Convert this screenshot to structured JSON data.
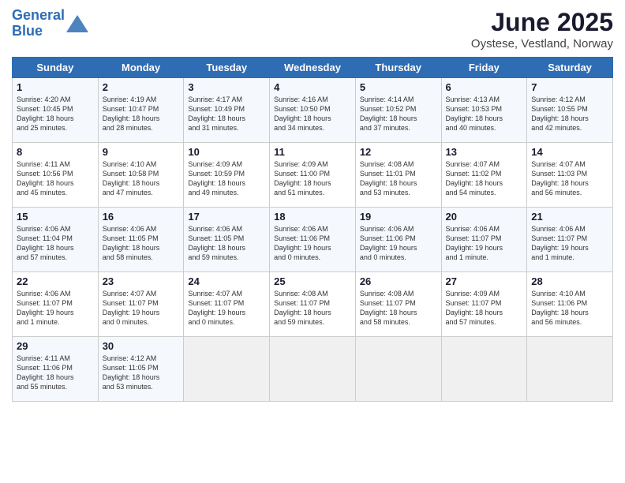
{
  "logo": {
    "line1": "General",
    "line2": "Blue"
  },
  "title": "June 2025",
  "location": "Oystese, Vestland, Norway",
  "days_of_week": [
    "Sunday",
    "Monday",
    "Tuesday",
    "Wednesday",
    "Thursday",
    "Friday",
    "Saturday"
  ],
  "weeks": [
    [
      {
        "day": "1",
        "info": "Sunrise: 4:20 AM\nSunset: 10:45 PM\nDaylight: 18 hours\nand 25 minutes."
      },
      {
        "day": "2",
        "info": "Sunrise: 4:19 AM\nSunset: 10:47 PM\nDaylight: 18 hours\nand 28 minutes."
      },
      {
        "day": "3",
        "info": "Sunrise: 4:17 AM\nSunset: 10:49 PM\nDaylight: 18 hours\nand 31 minutes."
      },
      {
        "day": "4",
        "info": "Sunrise: 4:16 AM\nSunset: 10:50 PM\nDaylight: 18 hours\nand 34 minutes."
      },
      {
        "day": "5",
        "info": "Sunrise: 4:14 AM\nSunset: 10:52 PM\nDaylight: 18 hours\nand 37 minutes."
      },
      {
        "day": "6",
        "info": "Sunrise: 4:13 AM\nSunset: 10:53 PM\nDaylight: 18 hours\nand 40 minutes."
      },
      {
        "day": "7",
        "info": "Sunrise: 4:12 AM\nSunset: 10:55 PM\nDaylight: 18 hours\nand 42 minutes."
      }
    ],
    [
      {
        "day": "8",
        "info": "Sunrise: 4:11 AM\nSunset: 10:56 PM\nDaylight: 18 hours\nand 45 minutes."
      },
      {
        "day": "9",
        "info": "Sunrise: 4:10 AM\nSunset: 10:58 PM\nDaylight: 18 hours\nand 47 minutes."
      },
      {
        "day": "10",
        "info": "Sunrise: 4:09 AM\nSunset: 10:59 PM\nDaylight: 18 hours\nand 49 minutes."
      },
      {
        "day": "11",
        "info": "Sunrise: 4:09 AM\nSunset: 11:00 PM\nDaylight: 18 hours\nand 51 minutes."
      },
      {
        "day": "12",
        "info": "Sunrise: 4:08 AM\nSunset: 11:01 PM\nDaylight: 18 hours\nand 53 minutes."
      },
      {
        "day": "13",
        "info": "Sunrise: 4:07 AM\nSunset: 11:02 PM\nDaylight: 18 hours\nand 54 minutes."
      },
      {
        "day": "14",
        "info": "Sunrise: 4:07 AM\nSunset: 11:03 PM\nDaylight: 18 hours\nand 56 minutes."
      }
    ],
    [
      {
        "day": "15",
        "info": "Sunrise: 4:06 AM\nSunset: 11:04 PM\nDaylight: 18 hours\nand 57 minutes."
      },
      {
        "day": "16",
        "info": "Sunrise: 4:06 AM\nSunset: 11:05 PM\nDaylight: 18 hours\nand 58 minutes."
      },
      {
        "day": "17",
        "info": "Sunrise: 4:06 AM\nSunset: 11:05 PM\nDaylight: 18 hours\nand 59 minutes."
      },
      {
        "day": "18",
        "info": "Sunrise: 4:06 AM\nSunset: 11:06 PM\nDaylight: 19 hours\nand 0 minutes."
      },
      {
        "day": "19",
        "info": "Sunrise: 4:06 AM\nSunset: 11:06 PM\nDaylight: 19 hours\nand 0 minutes."
      },
      {
        "day": "20",
        "info": "Sunrise: 4:06 AM\nSunset: 11:07 PM\nDaylight: 19 hours\nand 1 minute."
      },
      {
        "day": "21",
        "info": "Sunrise: 4:06 AM\nSunset: 11:07 PM\nDaylight: 19 hours\nand 1 minute."
      }
    ],
    [
      {
        "day": "22",
        "info": "Sunrise: 4:06 AM\nSunset: 11:07 PM\nDaylight: 19 hours\nand 1 minute."
      },
      {
        "day": "23",
        "info": "Sunrise: 4:07 AM\nSunset: 11:07 PM\nDaylight: 19 hours\nand 0 minutes."
      },
      {
        "day": "24",
        "info": "Sunrise: 4:07 AM\nSunset: 11:07 PM\nDaylight: 19 hours\nand 0 minutes."
      },
      {
        "day": "25",
        "info": "Sunrise: 4:08 AM\nSunset: 11:07 PM\nDaylight: 18 hours\nand 59 minutes."
      },
      {
        "day": "26",
        "info": "Sunrise: 4:08 AM\nSunset: 11:07 PM\nDaylight: 18 hours\nand 58 minutes."
      },
      {
        "day": "27",
        "info": "Sunrise: 4:09 AM\nSunset: 11:07 PM\nDaylight: 18 hours\nand 57 minutes."
      },
      {
        "day": "28",
        "info": "Sunrise: 4:10 AM\nSunset: 11:06 PM\nDaylight: 18 hours\nand 56 minutes."
      }
    ],
    [
      {
        "day": "29",
        "info": "Sunrise: 4:11 AM\nSunset: 11:06 PM\nDaylight: 18 hours\nand 55 minutes."
      },
      {
        "day": "30",
        "info": "Sunrise: 4:12 AM\nSunset: 11:05 PM\nDaylight: 18 hours\nand 53 minutes."
      },
      {
        "day": "",
        "info": ""
      },
      {
        "day": "",
        "info": ""
      },
      {
        "day": "",
        "info": ""
      },
      {
        "day": "",
        "info": ""
      },
      {
        "day": "",
        "info": ""
      }
    ]
  ]
}
